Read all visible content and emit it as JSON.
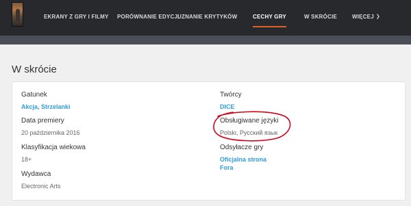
{
  "nav": {
    "items": [
      {
        "label": "Ekrany z gry i filmy",
        "active": false
      },
      {
        "label": "Porównanie edycji",
        "active": false
      },
      {
        "label": "Uznanie krytyków",
        "active": false
      },
      {
        "label": "Cechy gry",
        "active": true
      },
      {
        "label": "W skrócie",
        "active": false
      },
      {
        "label": "Więcej",
        "active": false
      }
    ]
  },
  "section": {
    "title": "W skrócie"
  },
  "details": {
    "genre": {
      "label": "Gatunek",
      "value": "Akcja, Strzelanki"
    },
    "release_date": {
      "label": "Data premiery",
      "value": "20 października 2016"
    },
    "rating": {
      "label": "Klasyfikacja wiekowa",
      "value": "18+"
    },
    "publisher": {
      "label": "Wydawca",
      "value": "Electronic Arts"
    },
    "developer": {
      "label": "Twórcy",
      "value": "DICE"
    },
    "languages": {
      "label": "Obsługiwane języki",
      "value": "Polski, Русский язык"
    },
    "links": {
      "label": "Odsyłacze gry",
      "official": "Oficjalna strona",
      "forum": "Fora"
    }
  },
  "colors": {
    "nav_background": "#27292d",
    "subband": "#4a4f57",
    "accent_underline": "#e0622a",
    "link": "#2d9cdb",
    "annotation": "#d0021b"
  }
}
